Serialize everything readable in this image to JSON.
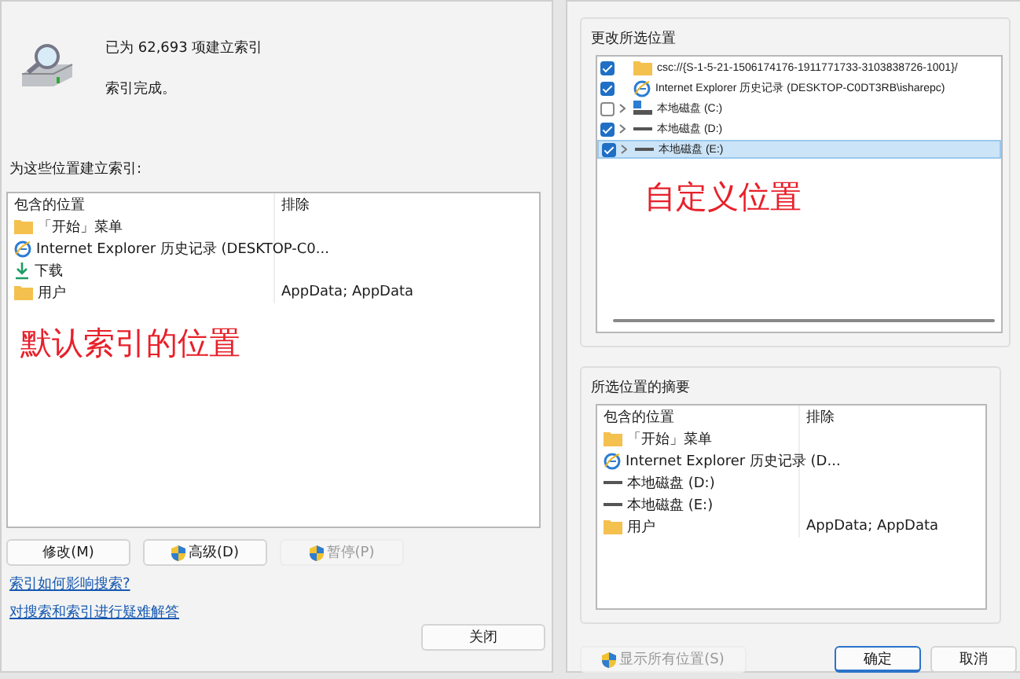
{
  "indexing_options": {
    "status_count": "已为 62,693 项建立索引",
    "status": "索引完成。",
    "locations_label": "为这些位置建立索引:",
    "table": {
      "columns": [
        "包含的位置",
        "排除"
      ],
      "rows": [
        {
          "kind": "folder",
          "location": "「开始」菜单",
          "exclude": ""
        },
        {
          "kind": "ie",
          "location": "Internet Explorer 历史记录 (DESKTOP-C0...",
          "exclude": ""
        },
        {
          "kind": "download",
          "location": "下载",
          "exclude": ""
        },
        {
          "kind": "folder",
          "location": "用户",
          "exclude": "AppData; AppData"
        }
      ]
    },
    "annotation": "默认索引的位置",
    "buttons": [
      {
        "label": "修改(M)",
        "shield": false,
        "disabled": false
      },
      {
        "label": "高级(D)",
        "shield": true,
        "disabled": false
      },
      {
        "label": "暂停(P)",
        "shield": true,
        "disabled": true
      }
    ],
    "links": [
      "索引如何影响搜索?",
      "对搜索和索引进行疑难解答"
    ],
    "close_button": "关闭"
  },
  "indexed_locations": {
    "change_label": "更改所选位置",
    "tree": [
      {
        "kind": "folder",
        "label": "csc://{S-1-5-21-1506174176-1911771733-3103838726-1001}/",
        "checked": true,
        "expandable": false,
        "selected": false
      },
      {
        "kind": "ie",
        "label": "Internet Explorer 历史记录 (DESKTOP-C0DT3RB\\isharepc)",
        "checked": true,
        "expandable": false,
        "selected": false
      },
      {
        "kind": "system-drive",
        "label": "本地磁盘 (C:)",
        "checked": false,
        "expandable": true,
        "selected": false
      },
      {
        "kind": "drive",
        "label": "本地磁盘 (D:)",
        "checked": true,
        "expandable": true,
        "selected": false
      },
      {
        "kind": "drive",
        "label": "本地磁盘 (E:)",
        "checked": true,
        "expandable": true,
        "selected": true
      }
    ],
    "annotation": "自定义位置",
    "summary_label": "所选位置的摘要",
    "summary": {
      "columns": [
        "包含的位置",
        "排除"
      ],
      "rows": [
        {
          "kind": "folder",
          "location": "「开始」菜单",
          "exclude": ""
        },
        {
          "kind": "ie",
          "location": "Internet Explorer 历史记录 (D...",
          "exclude": ""
        },
        {
          "kind": "drive",
          "location": "本地磁盘 (D:)",
          "exclude": ""
        },
        {
          "kind": "drive",
          "location": "本地磁盘 (E:)",
          "exclude": ""
        },
        {
          "kind": "folder",
          "location": "用户",
          "exclude": "AppData; AppData"
        }
      ]
    },
    "show_all_button": {
      "label": "显示所有位置(S)",
      "disabled": true
    },
    "ok_button": "确定",
    "cancel_button": "取消"
  }
}
